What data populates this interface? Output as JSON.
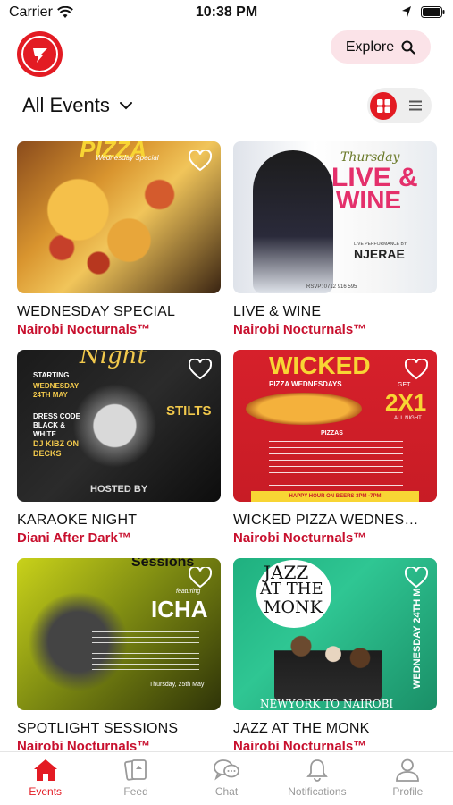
{
  "status_bar": {
    "carrier": "Carrier",
    "time": "10:38 PM"
  },
  "header": {
    "explore_label": "Explore"
  },
  "filter": {
    "label": "All Events"
  },
  "colors": {
    "accent": "#e31b23",
    "org": "#c8102e"
  },
  "events": [
    {
      "title": "WEDNESDAY SPECIAL",
      "org": "Nairobi Nocturnals™",
      "poster": {
        "headline": "PIZZA",
        "sub": "Wednesday Special"
      }
    },
    {
      "title": "LIVE & WINE",
      "org": "Nairobi Nocturnals™",
      "poster": {
        "line1": "Thursday",
        "line2": "LIVE &",
        "line3": "WINE",
        "performer_label": "LIVE PERFORMANCE BY",
        "performer": "NJERAE",
        "footer": "RSVP: 0712 916 595"
      }
    },
    {
      "title": "KARAOKE NIGHT",
      "org": "Diani After Dark™",
      "poster": {
        "headline": "Night",
        "starting": "STARTING",
        "date": "WEDNESDAY 24TH MAY",
        "dress": "DRESS CODE BLACK & WHITE",
        "dj": "DJ KIBZ ON DECKS",
        "venue": "STILTS",
        "hosted": "HOSTED BY"
      }
    },
    {
      "title": "WICKED PIZZA WEDNES…",
      "org": "Nairobi Nocturnals™",
      "poster": {
        "headline": "WICKED",
        "sub": "PIZZA WEDNESDAYS",
        "get": "GET",
        "offer": "2X1",
        "all_night": "ALL NIGHT",
        "menu_title": "PIZZAS",
        "footer": "HAPPY HOUR ON BEERS 3PM -7PM"
      }
    },
    {
      "title": "SPOTLIGHT SESSIONS",
      "org": "Nairobi Nocturnals™",
      "poster": {
        "headline": "Sessions",
        "featuring": "featuring",
        "artist": "ICHA",
        "date": "Thursday, 25th May"
      }
    },
    {
      "title": "JAZZ AT THE MONK",
      "org": "Nairobi Nocturnals™",
      "poster": {
        "line1": "JAZZ",
        "line2": "AT THE",
        "line3": "MONK",
        "side": "WEDNESDAY 24TH M",
        "footer": "NEWYORK TO NAIROBI"
      }
    }
  ],
  "tabs": [
    {
      "label": "Events",
      "icon": "home-icon",
      "active": true
    },
    {
      "label": "Feed",
      "icon": "feed-icon",
      "active": false
    },
    {
      "label": "Chat",
      "icon": "chat-icon",
      "active": false
    },
    {
      "label": "Notifications",
      "icon": "bell-icon",
      "active": false
    },
    {
      "label": "Profile",
      "icon": "profile-icon",
      "active": false
    }
  ]
}
